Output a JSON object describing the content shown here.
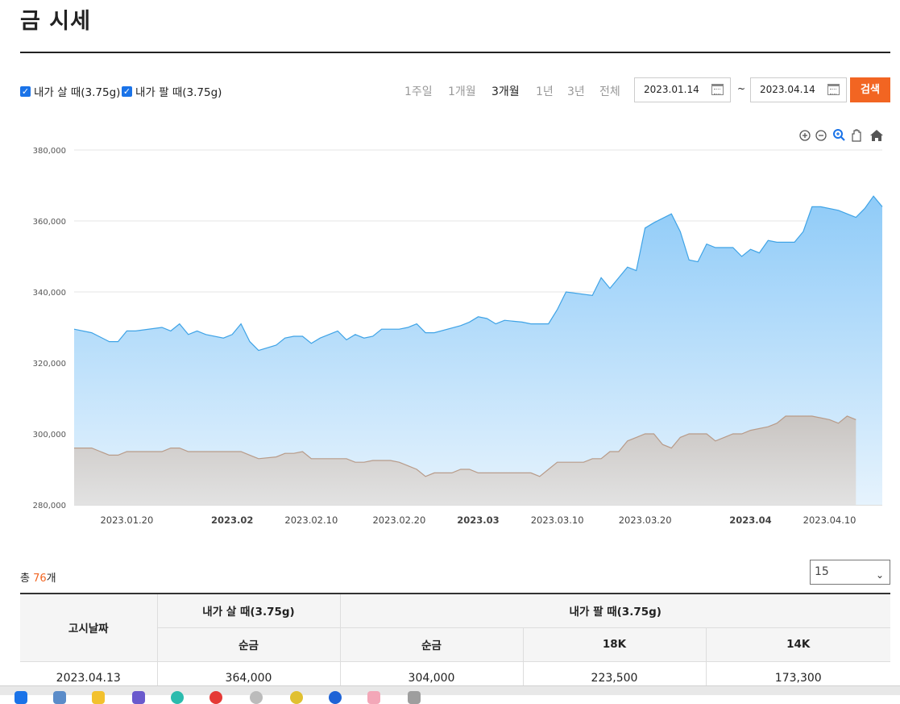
{
  "header": {
    "title": "금 시세"
  },
  "filters": {
    "checkbox_buy": "내가 살 때(3.75g)",
    "checkbox_sell": "내가 팔 때(3.75g)",
    "periods": [
      "1주일",
      "1개월",
      "3개월",
      "1년",
      "3년",
      "전체"
    ],
    "active_period": "3개월",
    "date_from": "2023.01.14",
    "date_to": "2023.04.14",
    "tilde": "~",
    "search_label": "검색"
  },
  "chart_toolbar": [
    "zoom-in-icon",
    "zoom-out-icon",
    "magnify-icon",
    "pan-hand-icon",
    "home-icon"
  ],
  "chart_data": {
    "type": "area",
    "title": "",
    "xlabel": "",
    "ylabel": "",
    "ylim": [
      280000,
      380000
    ],
    "y_ticks": [
      "280,000",
      "300,000",
      "320,000",
      "340,000",
      "360,000",
      "380,000"
    ],
    "x_ticks": [
      {
        "label": "2023.01.20",
        "day": 6,
        "bold": false
      },
      {
        "label": "2023.02",
        "day": 18,
        "bold": true
      },
      {
        "label": "2023.02.10",
        "day": 27,
        "bold": false
      },
      {
        "label": "2023.02.20",
        "day": 37,
        "bold": false
      },
      {
        "label": "2023.03",
        "day": 46,
        "bold": true
      },
      {
        "label": "2023.03.10",
        "day": 55,
        "bold": false
      },
      {
        "label": "2023.03.20",
        "day": 65,
        "bold": false
      },
      {
        "label": "2023.04",
        "day": 77,
        "bold": true
      },
      {
        "label": "2023.04.10",
        "day": 86,
        "bold": false
      }
    ],
    "grid": true,
    "legend": "none",
    "series": [
      {
        "color": "#3fa3e6",
        "points": [
          [
            0,
            329500
          ],
          [
            2,
            328500
          ],
          [
            4,
            326000
          ],
          [
            5,
            326000
          ],
          [
            6,
            329000
          ],
          [
            7,
            329000
          ],
          [
            10,
            330000
          ],
          [
            11,
            329000
          ],
          [
            12,
            331000
          ],
          [
            13,
            328000
          ],
          [
            14,
            329000
          ],
          [
            15,
            328000
          ],
          [
            17,
            327000
          ],
          [
            18,
            328000
          ],
          [
            19,
            331000
          ],
          [
            20,
            326000
          ],
          [
            21,
            323500
          ],
          [
            23,
            325000
          ],
          [
            24,
            327000
          ],
          [
            25,
            327500
          ],
          [
            26,
            327500
          ],
          [
            27,
            325500
          ],
          [
            28,
            327000
          ],
          [
            30,
            329000
          ],
          [
            31,
            326500
          ],
          [
            32,
            328000
          ],
          [
            33,
            327000
          ],
          [
            34,
            327500
          ],
          [
            35,
            329500
          ],
          [
            37,
            329500
          ],
          [
            38,
            330000
          ],
          [
            39,
            331000
          ],
          [
            40,
            328500
          ],
          [
            41,
            328500
          ],
          [
            44,
            330500
          ],
          [
            45,
            331500
          ],
          [
            46,
            333000
          ],
          [
            47,
            332500
          ],
          [
            48,
            331000
          ],
          [
            49,
            332000
          ],
          [
            51,
            331500
          ],
          [
            52,
            331000
          ],
          [
            54,
            331000
          ],
          [
            55,
            335000
          ],
          [
            56,
            340000
          ],
          [
            59,
            339000
          ],
          [
            60,
            344000
          ],
          [
            61,
            341000
          ],
          [
            62,
            344000
          ],
          [
            63,
            347000
          ],
          [
            64,
            346000
          ],
          [
            65,
            358000
          ],
          [
            66,
            359500
          ],
          [
            68,
            362000
          ],
          [
            69,
            357000
          ],
          [
            70,
            349000
          ],
          [
            71,
            348500
          ],
          [
            72,
            353500
          ],
          [
            73,
            352500
          ],
          [
            75,
            352500
          ],
          [
            76,
            350000
          ],
          [
            77,
            352000
          ],
          [
            78,
            351000
          ],
          [
            79,
            354500
          ],
          [
            80,
            354000
          ],
          [
            82,
            354000
          ],
          [
            83,
            357000
          ],
          [
            84,
            364000
          ],
          [
            85,
            364000
          ],
          [
            87,
            363000
          ],
          [
            89,
            361000
          ],
          [
            90,
            363500
          ],
          [
            91,
            367000
          ],
          [
            92,
            364000
          ]
        ]
      },
      {
        "color": "#b89b89",
        "points": [
          [
            0,
            296000
          ],
          [
            2,
            296000
          ],
          [
            3,
            295000
          ],
          [
            4,
            294000
          ],
          [
            5,
            294000
          ],
          [
            6,
            295000
          ],
          [
            10,
            295000
          ],
          [
            11,
            296000
          ],
          [
            12,
            296000
          ],
          [
            13,
            295000
          ],
          [
            19,
            295000
          ],
          [
            20,
            294000
          ],
          [
            21,
            293000
          ],
          [
            23,
            293500
          ],
          [
            24,
            294500
          ],
          [
            25,
            294500
          ],
          [
            26,
            295000
          ],
          [
            27,
            293000
          ],
          [
            30,
            293000
          ],
          [
            31,
            293000
          ],
          [
            32,
            292000
          ],
          [
            33,
            292000
          ],
          [
            34,
            292500
          ],
          [
            36,
            292500
          ],
          [
            37,
            292000
          ],
          [
            38,
            291000
          ],
          [
            39,
            290000
          ],
          [
            40,
            288000
          ],
          [
            41,
            289000
          ],
          [
            43,
            289000
          ],
          [
            44,
            290000
          ],
          [
            45,
            290000
          ],
          [
            46,
            289000
          ],
          [
            51,
            289000
          ],
          [
            52,
            289000
          ],
          [
            53,
            288000
          ],
          [
            54,
            290000
          ],
          [
            55,
            292000
          ],
          [
            58,
            292000
          ],
          [
            59,
            293000
          ],
          [
            60,
            293000
          ],
          [
            61,
            295000
          ],
          [
            62,
            295000
          ],
          [
            63,
            298000
          ],
          [
            64,
            299000
          ],
          [
            65,
            300000
          ],
          [
            66,
            300000
          ],
          [
            67,
            297000
          ],
          [
            68,
            296000
          ],
          [
            69,
            299000
          ],
          [
            70,
            300000
          ],
          [
            72,
            300000
          ],
          [
            73,
            298000
          ],
          [
            74,
            299000
          ],
          [
            75,
            300000
          ],
          [
            76,
            300000
          ],
          [
            77,
            301000
          ],
          [
            79,
            302000
          ],
          [
            80,
            303000
          ],
          [
            81,
            305000
          ],
          [
            84,
            305000
          ],
          [
            86,
            304000
          ],
          [
            87,
            303000
          ],
          [
            88,
            305000
          ],
          [
            89,
            304000
          ]
        ]
      }
    ]
  },
  "summary": {
    "prefix": "총 ",
    "count": "76",
    "suffix": "개"
  },
  "pagesize": {
    "value": "15"
  },
  "table": {
    "col_date": "고시날짜",
    "group_buy": "내가 살 때(3.75g)",
    "group_sell": "내가 팔 때(3.75g)",
    "sub_headers": [
      "순금",
      "순금",
      "18K",
      "14K"
    ],
    "rows": [
      [
        "2023.04.13",
        "364,000",
        "304,000",
        "223,500",
        "173,300"
      ]
    ]
  }
}
